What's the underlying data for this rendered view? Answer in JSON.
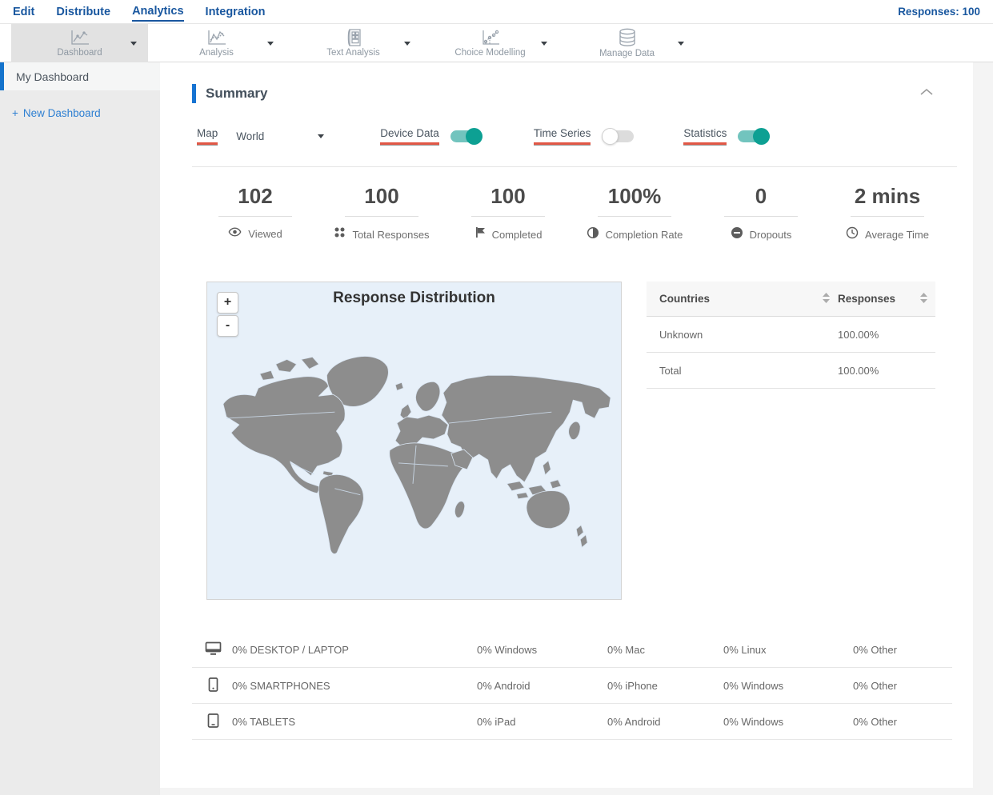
{
  "nav": {
    "items": [
      "Edit",
      "Distribute",
      "Analytics",
      "Integration"
    ],
    "active": "Analytics",
    "responses_label": "Responses: 100"
  },
  "toolbar": {
    "items": [
      {
        "label": "Dashboard",
        "icon": "line-chart-icon",
        "selected": true
      },
      {
        "label": "Analysis",
        "icon": "line-chart-icon",
        "selected": false
      },
      {
        "label": "Text Analysis",
        "icon": "document-grid-icon",
        "selected": false
      },
      {
        "label": "Choice Modelling",
        "icon": "scatter-chart-icon",
        "selected": false
      },
      {
        "label": "Manage Data",
        "icon": "database-icon",
        "selected": false
      }
    ]
  },
  "sidebar": {
    "selected": "My Dashboard",
    "new_dashboard": {
      "plus": "+",
      "label": "New Dashboard"
    }
  },
  "summary": {
    "title": "Summary",
    "controls": {
      "map_label": "Map",
      "map_value": "World",
      "device_data_label": "Device Data",
      "device_data_on": true,
      "time_series_label": "Time Series",
      "time_series_on": false,
      "statistics_label": "Statistics",
      "statistics_on": true
    },
    "stats": [
      {
        "value": "102",
        "label": "Viewed",
        "icon": "eye-icon"
      },
      {
        "value": "100",
        "label": "Total Responses",
        "icon": "grid-dots-icon"
      },
      {
        "value": "100",
        "label": "Completed",
        "icon": "flag-icon"
      },
      {
        "value": "100%",
        "label": "Completion Rate",
        "icon": "contrast-circle-icon"
      },
      {
        "value": "0",
        "label": "Dropouts",
        "icon": "minus-circle-icon"
      },
      {
        "value": "2 mins",
        "label": "Average Time",
        "icon": "clock-icon"
      }
    ],
    "map": {
      "title": "Response Distribution",
      "zoom_in": "+",
      "zoom_out": "-"
    },
    "countries_table": {
      "headers": [
        "Countries",
        "Responses"
      ],
      "rows": [
        [
          "Unknown",
          "100.00%"
        ],
        [
          "Total",
          "100.00%"
        ]
      ]
    },
    "device_table": {
      "rows": [
        {
          "icon": "desktop-icon",
          "label": "0% DESKTOP / LAPTOP",
          "cols": [
            "0% Windows",
            "0% Mac",
            "0% Linux",
            "0% Other"
          ]
        },
        {
          "icon": "smartphone-icon",
          "label": "0% SMARTPHONES",
          "cols": [
            "0% Android",
            "0% iPhone",
            "0% Windows",
            "0% Other"
          ]
        },
        {
          "icon": "tablet-icon",
          "label": "0% TABLETS",
          "cols": [
            "0% iPad",
            "0% Android",
            "0% Windows",
            "0% Other"
          ]
        }
      ]
    }
  },
  "colors": {
    "accent_blue": "#19579f",
    "sidebar_accent": "#1473cc",
    "underline_red": "#e25746",
    "toggle_teal": "#0da093",
    "map_background": "#e7f0f9",
    "land_gray": "#8d8d8d"
  }
}
